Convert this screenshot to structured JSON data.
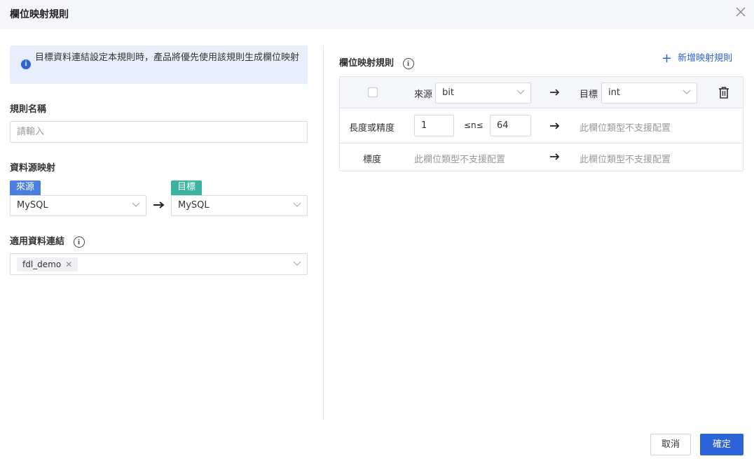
{
  "dialog": {
    "title": "欄位映射規則",
    "close_icon": "close-icon"
  },
  "info": {
    "text": "目標資料連結設定本規則時，產品將優先使用該規則生成欄位映射"
  },
  "rule_name": {
    "label": "規則名稱",
    "placeholder": "請輸入",
    "value": ""
  },
  "source_mapping": {
    "label": "資料源映射",
    "source_tag": "來源",
    "target_tag": "目標",
    "source_value": "MySQL",
    "target_value": "MySQL"
  },
  "connections": {
    "label": "適用資料連結",
    "chips": [
      "fdl_demo"
    ]
  },
  "mapping_rules": {
    "title": "欄位映射規則",
    "add_label": "新增映射規則",
    "header": {
      "source_label": "來源",
      "source_value": "bit",
      "target_label": "目標",
      "target_value": "int"
    },
    "rows": [
      {
        "label": "長度或精度",
        "min": "1",
        "op": "≤n≤",
        "max": "64",
        "target_text": "此欄位類型不支援配置"
      },
      {
        "label": "標度",
        "source_text": "此欄位類型不支援配置",
        "target_text": "此欄位類型不支援配置"
      }
    ]
  },
  "footer": {
    "cancel_label": "取消",
    "ok_label": "確定"
  },
  "colors": {
    "primary": "#2d63d8",
    "source_tag": "#4a7fe0",
    "target_tag": "#3bb3a0",
    "info_bg": "#e8effc"
  }
}
